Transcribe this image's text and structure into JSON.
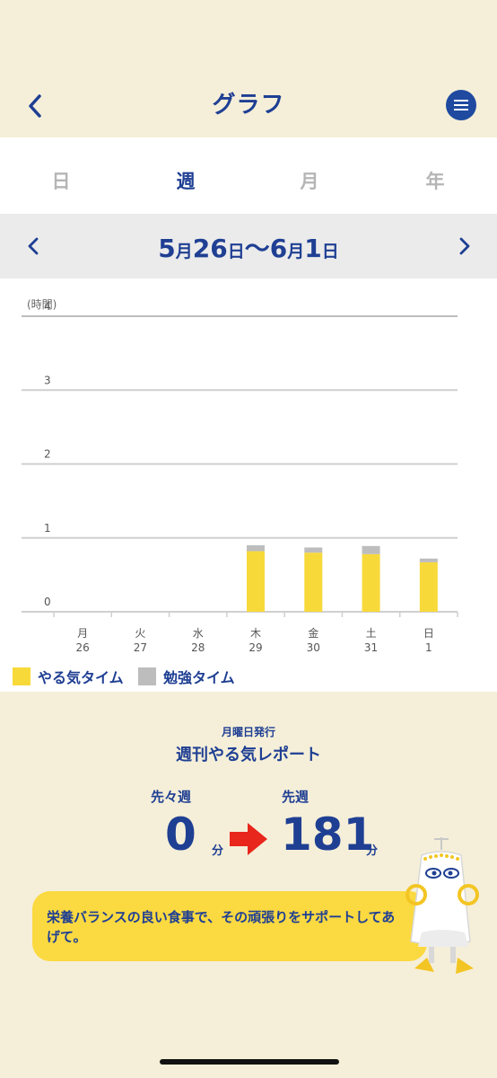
{
  "header": {
    "title": "グラフ",
    "back_icon": "chevron-left-icon",
    "menu_icon": "hamburger-menu-icon"
  },
  "tabs": [
    {
      "label": "日",
      "active": false
    },
    {
      "label": "週",
      "active": true
    },
    {
      "label": "月",
      "active": false
    },
    {
      "label": "年",
      "active": false
    }
  ],
  "range": {
    "start_month": "5",
    "start_day": "26",
    "end_month": "6",
    "end_day": "1",
    "month_unit": "月",
    "day_unit": "日",
    "separator": "〜"
  },
  "chart_data": {
    "type": "bar",
    "stacked": true,
    "ylabel": "(時間)",
    "ylim": [
      0,
      4
    ],
    "yticks": [
      "0",
      "1",
      "2",
      "3",
      "4"
    ],
    "categories": [
      {
        "weekday": "月",
        "day": "26"
      },
      {
        "weekday": "火",
        "day": "27"
      },
      {
        "weekday": "水",
        "day": "28"
      },
      {
        "weekday": "木",
        "day": "29"
      },
      {
        "weekday": "金",
        "day": "30"
      },
      {
        "weekday": "土",
        "day": "31"
      },
      {
        "weekday": "日",
        "day": "1"
      }
    ],
    "series": [
      {
        "name": "やる気タイム",
        "color": "#f8d93a",
        "values": [
          0,
          0,
          0,
          0.82,
          0.8,
          0.78,
          0.67
        ]
      },
      {
        "name": "勉強タイム",
        "color": "#bdbdbd",
        "values": [
          0,
          0,
          0,
          0.08,
          0.07,
          0.11,
          0.05
        ]
      }
    ],
    "grid": true
  },
  "report": {
    "subtitle": "月曜日発行",
    "title": "週刊やる気レポート",
    "before_last_label": "先々週",
    "last_label": "先週",
    "before_last_value": "0",
    "last_value": "181",
    "unit": "分",
    "message": "栄養バランスの良い食事で、その頑張りをサポートしてあげて。"
  }
}
